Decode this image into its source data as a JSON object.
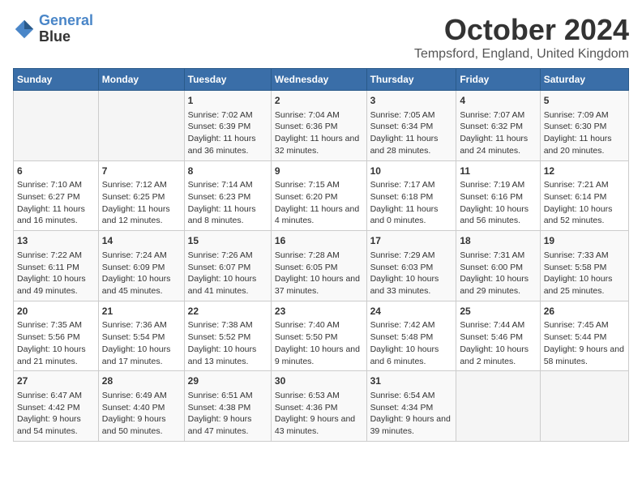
{
  "header": {
    "logo_line1": "General",
    "logo_line2": "Blue",
    "month": "October 2024",
    "location": "Tempsford, England, United Kingdom"
  },
  "days_of_week": [
    "Sunday",
    "Monday",
    "Tuesday",
    "Wednesday",
    "Thursday",
    "Friday",
    "Saturday"
  ],
  "weeks": [
    [
      {
        "day": "",
        "sunrise": "",
        "sunset": "",
        "daylight": ""
      },
      {
        "day": "",
        "sunrise": "",
        "sunset": "",
        "daylight": ""
      },
      {
        "day": "1",
        "sunrise": "Sunrise: 7:02 AM",
        "sunset": "Sunset: 6:39 PM",
        "daylight": "Daylight: 11 hours and 36 minutes."
      },
      {
        "day": "2",
        "sunrise": "Sunrise: 7:04 AM",
        "sunset": "Sunset: 6:36 PM",
        "daylight": "Daylight: 11 hours and 32 minutes."
      },
      {
        "day": "3",
        "sunrise": "Sunrise: 7:05 AM",
        "sunset": "Sunset: 6:34 PM",
        "daylight": "Daylight: 11 hours and 28 minutes."
      },
      {
        "day": "4",
        "sunrise": "Sunrise: 7:07 AM",
        "sunset": "Sunset: 6:32 PM",
        "daylight": "Daylight: 11 hours and 24 minutes."
      },
      {
        "day": "5",
        "sunrise": "Sunrise: 7:09 AM",
        "sunset": "Sunset: 6:30 PM",
        "daylight": "Daylight: 11 hours and 20 minutes."
      }
    ],
    [
      {
        "day": "6",
        "sunrise": "Sunrise: 7:10 AM",
        "sunset": "Sunset: 6:27 PM",
        "daylight": "Daylight: 11 hours and 16 minutes."
      },
      {
        "day": "7",
        "sunrise": "Sunrise: 7:12 AM",
        "sunset": "Sunset: 6:25 PM",
        "daylight": "Daylight: 11 hours and 12 minutes."
      },
      {
        "day": "8",
        "sunrise": "Sunrise: 7:14 AM",
        "sunset": "Sunset: 6:23 PM",
        "daylight": "Daylight: 11 hours and 8 minutes."
      },
      {
        "day": "9",
        "sunrise": "Sunrise: 7:15 AM",
        "sunset": "Sunset: 6:20 PM",
        "daylight": "Daylight: 11 hours and 4 minutes."
      },
      {
        "day": "10",
        "sunrise": "Sunrise: 7:17 AM",
        "sunset": "Sunset: 6:18 PM",
        "daylight": "Daylight: 11 hours and 0 minutes."
      },
      {
        "day": "11",
        "sunrise": "Sunrise: 7:19 AM",
        "sunset": "Sunset: 6:16 PM",
        "daylight": "Daylight: 10 hours and 56 minutes."
      },
      {
        "day": "12",
        "sunrise": "Sunrise: 7:21 AM",
        "sunset": "Sunset: 6:14 PM",
        "daylight": "Daylight: 10 hours and 52 minutes."
      }
    ],
    [
      {
        "day": "13",
        "sunrise": "Sunrise: 7:22 AM",
        "sunset": "Sunset: 6:11 PM",
        "daylight": "Daylight: 10 hours and 49 minutes."
      },
      {
        "day": "14",
        "sunrise": "Sunrise: 7:24 AM",
        "sunset": "Sunset: 6:09 PM",
        "daylight": "Daylight: 10 hours and 45 minutes."
      },
      {
        "day": "15",
        "sunrise": "Sunrise: 7:26 AM",
        "sunset": "Sunset: 6:07 PM",
        "daylight": "Daylight: 10 hours and 41 minutes."
      },
      {
        "day": "16",
        "sunrise": "Sunrise: 7:28 AM",
        "sunset": "Sunset: 6:05 PM",
        "daylight": "Daylight: 10 hours and 37 minutes."
      },
      {
        "day": "17",
        "sunrise": "Sunrise: 7:29 AM",
        "sunset": "Sunset: 6:03 PM",
        "daylight": "Daylight: 10 hours and 33 minutes."
      },
      {
        "day": "18",
        "sunrise": "Sunrise: 7:31 AM",
        "sunset": "Sunset: 6:00 PM",
        "daylight": "Daylight: 10 hours and 29 minutes."
      },
      {
        "day": "19",
        "sunrise": "Sunrise: 7:33 AM",
        "sunset": "Sunset: 5:58 PM",
        "daylight": "Daylight: 10 hours and 25 minutes."
      }
    ],
    [
      {
        "day": "20",
        "sunrise": "Sunrise: 7:35 AM",
        "sunset": "Sunset: 5:56 PM",
        "daylight": "Daylight: 10 hours and 21 minutes."
      },
      {
        "day": "21",
        "sunrise": "Sunrise: 7:36 AM",
        "sunset": "Sunset: 5:54 PM",
        "daylight": "Daylight: 10 hours and 17 minutes."
      },
      {
        "day": "22",
        "sunrise": "Sunrise: 7:38 AM",
        "sunset": "Sunset: 5:52 PM",
        "daylight": "Daylight: 10 hours and 13 minutes."
      },
      {
        "day": "23",
        "sunrise": "Sunrise: 7:40 AM",
        "sunset": "Sunset: 5:50 PM",
        "daylight": "Daylight: 10 hours and 9 minutes."
      },
      {
        "day": "24",
        "sunrise": "Sunrise: 7:42 AM",
        "sunset": "Sunset: 5:48 PM",
        "daylight": "Daylight: 10 hours and 6 minutes."
      },
      {
        "day": "25",
        "sunrise": "Sunrise: 7:44 AM",
        "sunset": "Sunset: 5:46 PM",
        "daylight": "Daylight: 10 hours and 2 minutes."
      },
      {
        "day": "26",
        "sunrise": "Sunrise: 7:45 AM",
        "sunset": "Sunset: 5:44 PM",
        "daylight": "Daylight: 9 hours and 58 minutes."
      }
    ],
    [
      {
        "day": "27",
        "sunrise": "Sunrise: 6:47 AM",
        "sunset": "Sunset: 4:42 PM",
        "daylight": "Daylight: 9 hours and 54 minutes."
      },
      {
        "day": "28",
        "sunrise": "Sunrise: 6:49 AM",
        "sunset": "Sunset: 4:40 PM",
        "daylight": "Daylight: 9 hours and 50 minutes."
      },
      {
        "day": "29",
        "sunrise": "Sunrise: 6:51 AM",
        "sunset": "Sunset: 4:38 PM",
        "daylight": "Daylight: 9 hours and 47 minutes."
      },
      {
        "day": "30",
        "sunrise": "Sunrise: 6:53 AM",
        "sunset": "Sunset: 4:36 PM",
        "daylight": "Daylight: 9 hours and 43 minutes."
      },
      {
        "day": "31",
        "sunrise": "Sunrise: 6:54 AM",
        "sunset": "Sunset: 4:34 PM",
        "daylight": "Daylight: 9 hours and 39 minutes."
      },
      {
        "day": "",
        "sunrise": "",
        "sunset": "",
        "daylight": ""
      },
      {
        "day": "",
        "sunrise": "",
        "sunset": "",
        "daylight": ""
      }
    ]
  ]
}
